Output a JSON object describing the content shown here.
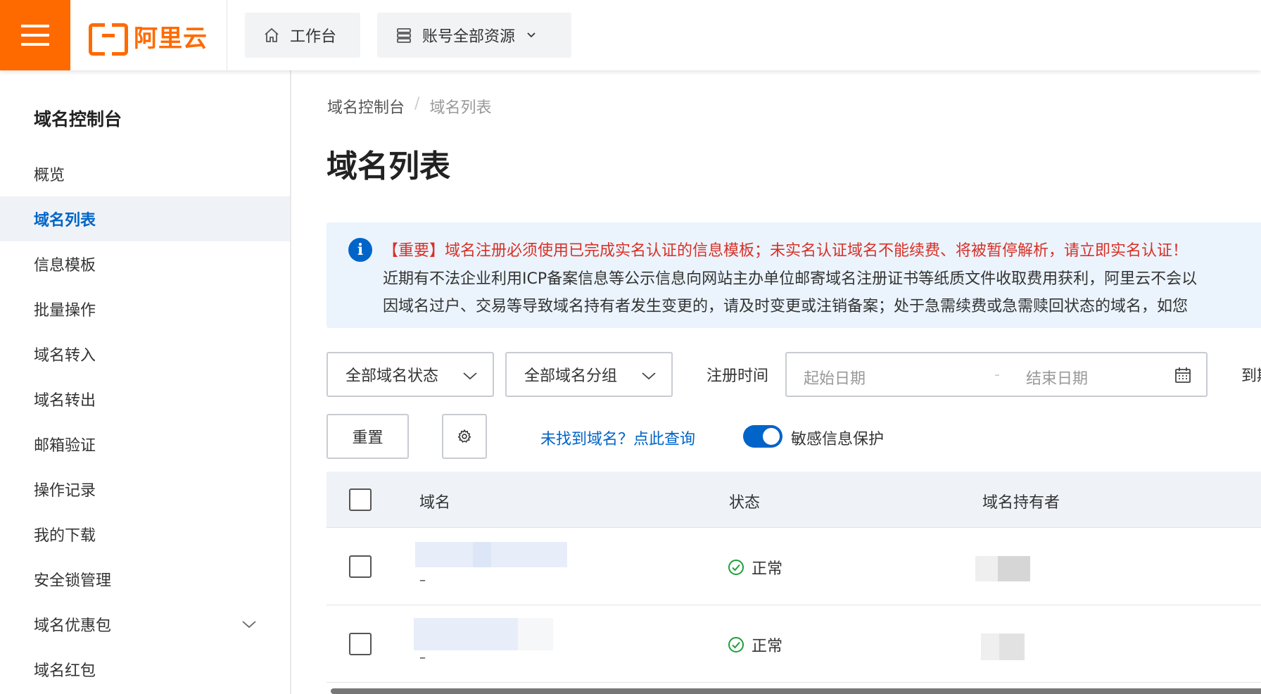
{
  "header": {
    "logo_text": "阿里云",
    "home_label": "工作台",
    "resources_label": "账号全部资源",
    "brand_color": "#ff6a00"
  },
  "sidebar": {
    "title": "域名控制台",
    "items": [
      {
        "label": "概览"
      },
      {
        "label": "域名列表",
        "active": true
      },
      {
        "label": "信息模板"
      },
      {
        "label": "批量操作"
      },
      {
        "label": "域名转入"
      },
      {
        "label": "域名转出"
      },
      {
        "label": "邮箱验证"
      },
      {
        "label": "操作记录"
      },
      {
        "label": "我的下载"
      },
      {
        "label": "安全锁管理"
      },
      {
        "label": "域名优惠包",
        "expandable": true
      },
      {
        "label": "域名红包"
      }
    ]
  },
  "breadcrumb": {
    "root": "域名控制台",
    "separator": "/",
    "current": "域名列表"
  },
  "page_title": "域名列表",
  "notice": {
    "line1": "【重要】域名注册必须使用已完成实名认证的信息模板；未实名认证域名不能续费、将被暂停解析，请立即实名认证！",
    "line2": "近期有不法企业利用ICP备案信息等公示信息向网站主办单位邮寄域名注册证书等纸质文件收取费用获利，阿里云不会以",
    "line3": "因域名过户、交易等导致域名持有者发生变更的，请及时变更或注销备案；处于急需续费或急需赎回状态的域名，如您"
  },
  "filters": {
    "status_select": "全部域名状态",
    "group_select": "全部域名分组",
    "reg_time_label": "注册时间",
    "start_placeholder": "起始日期",
    "range_separator": "-",
    "end_placeholder": "结束日期",
    "expire_label": "到期"
  },
  "actions": {
    "reset_label": "重置",
    "query_link": "未找到域名？点此查询",
    "sensitive_label": "敏感信息保护",
    "sensitive_on": true
  },
  "table": {
    "columns": [
      "域名",
      "状态",
      "域名持有者"
    ],
    "rows": [
      {
        "domain_note": "–",
        "status": "正常"
      },
      {
        "domain_note": "–",
        "status": "正常"
      }
    ]
  }
}
